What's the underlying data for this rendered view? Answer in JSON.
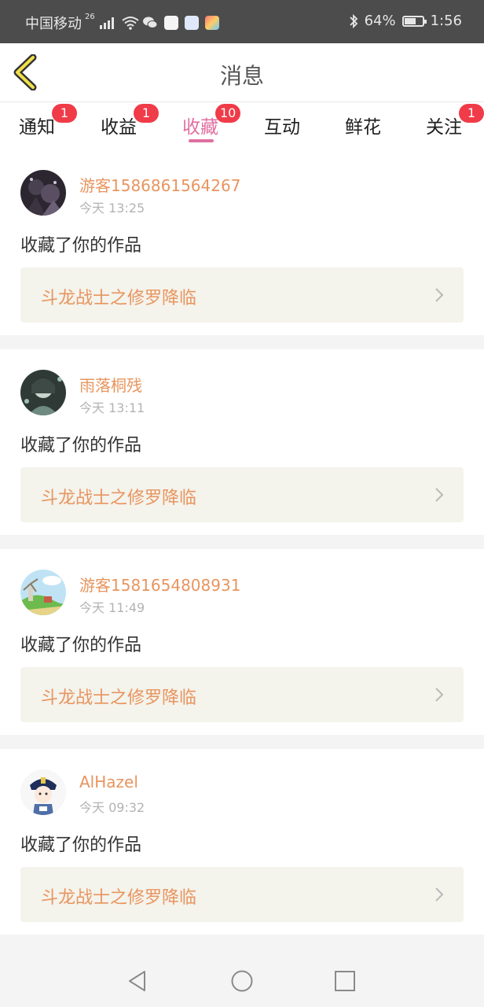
{
  "status_bar": {
    "carrier": "中国移动",
    "network": "26",
    "battery": "64%",
    "battery_level": 0.64,
    "time": "1:56"
  },
  "header": {
    "title": "消息"
  },
  "tabs": [
    {
      "label": "通知",
      "badge": "1",
      "active": false
    },
    {
      "label": "收益",
      "badge": "1",
      "active": false
    },
    {
      "label": "收藏",
      "badge": "10",
      "active": true
    },
    {
      "label": "互动",
      "badge": "",
      "active": false
    },
    {
      "label": "鲜花",
      "badge": "",
      "active": false
    },
    {
      "label": "关注",
      "badge": "1",
      "active": false
    }
  ],
  "messages": [
    {
      "username": "游客1586861564267",
      "time": "今天 13:25",
      "action": "收藏了你的作品",
      "work_title": "斗龙战士之修罗降临",
      "avatar_icon": "dark-anime-avatar"
    },
    {
      "username": "雨落桐残",
      "time": "今天 13:11",
      "action": "收藏了你的作品",
      "work_title": "斗龙战士之修罗降临",
      "avatar_icon": "teal-anime-avatar"
    },
    {
      "username": "游客1581654808931",
      "time": "今天 11:49",
      "action": "收藏了你的作品",
      "work_title": "斗龙战士之修罗降临",
      "avatar_icon": "landscape-avatar"
    },
    {
      "username": "AlHazel",
      "time": "今天 09:32",
      "action": "收藏了你的作品",
      "work_title": "斗龙战士之修罗降临",
      "avatar_icon": "cartoon-character-avatar"
    }
  ],
  "colors": {
    "accent_pink": "#e06fa0",
    "username_orange": "#e8955f",
    "badge_red": "#f03b48",
    "back_arrow_yellow": "#f0e04a"
  }
}
